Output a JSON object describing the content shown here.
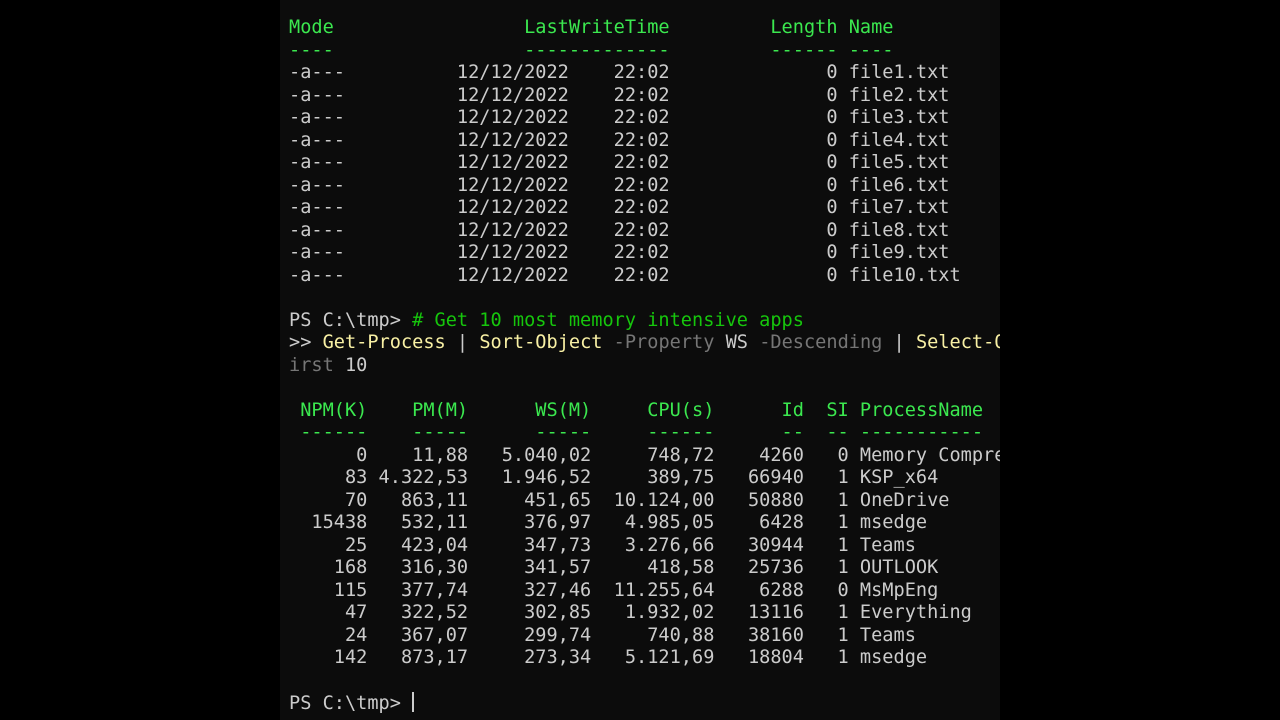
{
  "colors": {
    "background": "#0c0c0c",
    "text": "#cccccc",
    "header": "#3be84f",
    "comment": "#16c60c",
    "command": "#f9f1a5",
    "parameter": "#767676"
  },
  "file_listing": {
    "header": "Mode                 LastWriteTime         Length Name",
    "underline": "----                 -------------         ------ ----",
    "rows": [
      "-a---          12/12/2022    22:02              0 file1.txt",
      "-a---          12/12/2022    22:02              0 file2.txt",
      "-a---          12/12/2022    22:02              0 file3.txt",
      "-a---          12/12/2022    22:02              0 file4.txt",
      "-a---          12/12/2022    22:02              0 file5.txt",
      "-a---          12/12/2022    22:02              0 file6.txt",
      "-a---          12/12/2022    22:02              0 file7.txt",
      "-a---          12/12/2022    22:02              0 file8.txt",
      "-a---          12/12/2022    22:02              0 file9.txt",
      "-a---          12/12/2022    22:02              0 file10.txt"
    ]
  },
  "command_block": {
    "prompt": "PS C:\\tmp> ",
    "comment": "# Get 10 most memory intensive apps",
    "continuation": ">> ",
    "cmd1": "Get-Process",
    "pipe1": " | ",
    "cmd2": "Sort-Object",
    "param1": " -Property",
    "arg1": " WS",
    "param2": " -Descending",
    "pipe2": " | ",
    "cmd3": "Select-O",
    "wrap_text": "irst",
    "wrap_arg": " 10"
  },
  "process_table": {
    "header": " NPM(K)    PM(M)      WS(M)     CPU(s)      Id  SI ProcessName",
    "underline": " ------    -----      -----     ------      --  -- -----------",
    "rows": [
      "      0    11,88   5.040,02     748,72    4260   0 Memory Compre",
      "     83 4.322,53   1.946,52     389,75   66940   1 KSP_x64",
      "     70   863,11     451,65  10.124,00   50880   1 OneDrive",
      "  15438   532,11     376,97   4.985,05    6428   1 msedge",
      "     25   423,04     347,73   3.276,66   30944   1 Teams",
      "    168   316,30     341,57     418,58   25736   1 OUTLOOK",
      "    115   377,74     327,46  11.255,64    6288   0 MsMpEng",
      "     47   322,52     302,85   1.932,02   13116   1 Everything",
      "     24   367,07     299,74     740,88   38160   1 Teams",
      "    142   873,17     273,34   5.121,69   18804   1 msedge"
    ]
  },
  "final_prompt": "PS C:\\tmp> "
}
